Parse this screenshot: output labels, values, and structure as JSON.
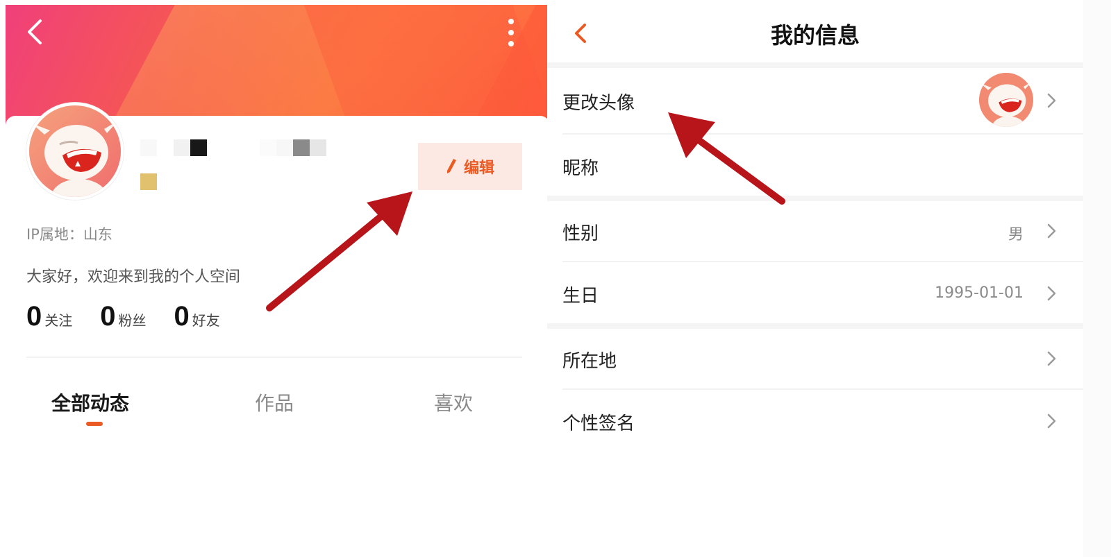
{
  "left": {
    "ip_location": "IP属地：山东",
    "bio": "大家好，欢迎来到我的个人空间",
    "edit_button": "编辑",
    "stats": [
      {
        "num": "0",
        "label": "关注"
      },
      {
        "num": "0",
        "label": "粉丝"
      },
      {
        "num": "0",
        "label": "好友"
      }
    ],
    "tabs": [
      {
        "label": "全部动态",
        "active": true
      },
      {
        "label": "作品",
        "active": false
      },
      {
        "label": "喜欢",
        "active": false
      }
    ],
    "icons": {
      "back": "back-arrow-icon",
      "more": "more-vertical-icon",
      "edit": "pencil-icon"
    }
  },
  "right": {
    "title": "我的信息",
    "rows": [
      {
        "label": "更改头像",
        "value": ""
      },
      {
        "label": "昵称",
        "value": ""
      },
      {
        "label": "性别",
        "value": "男"
      },
      {
        "label": "生日",
        "value": "1995-01-01"
      },
      {
        "label": "所在地",
        "value": ""
      },
      {
        "label": "个性签名",
        "value": ""
      }
    ]
  },
  "colors": {
    "accent": "#ea5a22",
    "banner_start": "#f0407a",
    "banner_end": "#ff5a3a",
    "annotation_arrow": "#b8151a"
  }
}
